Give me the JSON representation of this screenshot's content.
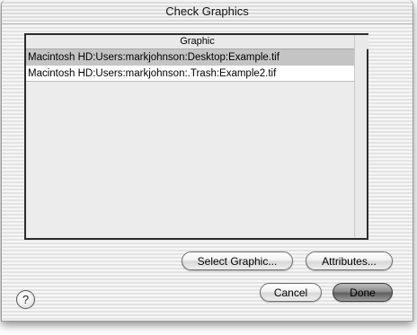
{
  "window": {
    "title": "Check Graphics"
  },
  "list": {
    "column_header": "Graphic",
    "rows": [
      {
        "path": "Macintosh HD:Users:markjohnson:Desktop:Example.tif",
        "selected": true
      },
      {
        "path": "Macintosh HD:Users:markjohnson:.Trash:Example2.tif",
        "selected": false
      }
    ]
  },
  "buttons": {
    "select_graphic": "Select Graphic...",
    "attributes": "Attributes...",
    "cancel": "Cancel",
    "done": "Done"
  },
  "help": {
    "glyph": "?"
  },
  "colors": {
    "selected_row": "#c4c4c4",
    "default_button": "#6a6a6a"
  }
}
